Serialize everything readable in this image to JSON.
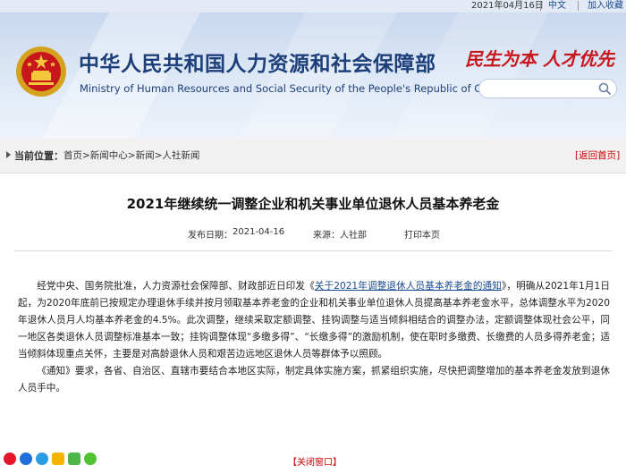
{
  "topbar": {
    "date": "2021年04月16日",
    "lang_label": "中文",
    "favorite_label": "加入收藏"
  },
  "header": {
    "site_name_cn": "中华人民共和国人力资源和社会保障部",
    "site_name_en": "Ministry of Human Resources and Social Security of the People's Republic of China",
    "slogan": "民生为本 人才优先",
    "search": {
      "value": "",
      "placeholder": ""
    }
  },
  "breadcrumb": {
    "label": "当前位置：",
    "path": "首页>新闻中心>新闻>人社新闻",
    "back_label": "[返回首页]"
  },
  "article": {
    "title": "2021年继续统一调整企业和机关事业单位退休人员基本养老金",
    "publish_label": "发布日期：",
    "publish_date": "2021-04-16",
    "source_label": "来源：",
    "source_value": "人社部",
    "print_label": "打印本页",
    "p1_a": "经党中央、国务院批准，人力资源社会保障部、财政部近日印发《",
    "p1_link": "关于2021年调整退休人员基本养老金的通知",
    "p1_b": "》，明确从2021年1月1日起，为2020年底前已按规定办理退休手续并按月领取基本养老金的企业和机关事业单位退休人员提高基本养老金水平，总体调整水平为2020年退休人员月人均基本养老金的4.5%。此次调整，继续采取定额调整、挂钩调整与适当倾斜相结合的调整办法，定额调整体现社会公平，同一地区各类退休人员调整标准基本一致；挂钩调整体现“多缴多得”、“长缴多得”的激励机制，使在职时多缴费、长缴费的人员多得养老金；适当倾斜体现重点关怀，主要是对高龄退休人员和艰苦边远地区退休人员等群体予以照顾。",
    "p2": "《通知》要求，各省、自治区、直辖市要结合本地区实际，制定具体实施方案，抓紧组织实施，尽快把调整增加的基本养老金发放到退休人员手中。"
  },
  "footer": {
    "close_label": "【关闭窗口】",
    "share_icons": [
      "weibo-icon",
      "renren-icon",
      "tencent-weibo-icon",
      "qzone-icon",
      "wechat-icon"
    ]
  },
  "colors": {
    "brand_blue": "#1d3f7a",
    "accent_red": "#c8161d",
    "link_blue": "#1a4a8f"
  }
}
